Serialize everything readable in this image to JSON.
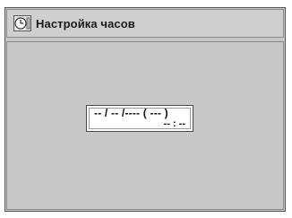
{
  "header": {
    "title": "Настройка часов",
    "icon": "clock-icon"
  },
  "clock": {
    "date_text": "-- / -- /---- ( --- )",
    "time_text": "-- : --"
  },
  "colors": {
    "background": "#c8c8c8",
    "header_bg": "#cfcfcf",
    "border": "#555555",
    "field_bg": "#ffffff"
  }
}
